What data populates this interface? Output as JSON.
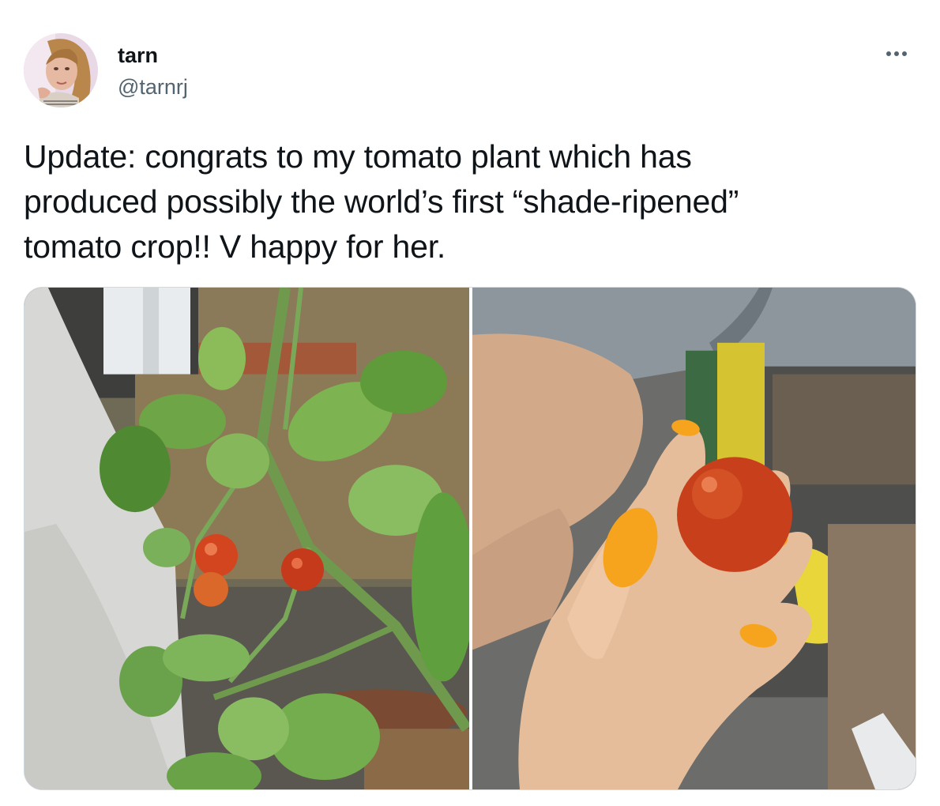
{
  "author": {
    "name": "tarn",
    "handle": "@tarnrj",
    "avatar_icon": "profile-photo"
  },
  "more_icon": "more-options-icon",
  "tweet": {
    "text": "Update: congrats to my tomato plant which has\nproduced possibly the world’s first “shade-ripened”\ntomato crop!! V happy for her."
  },
  "media": [
    {
      "name": "tomato-plant-photo"
    },
    {
      "name": "hand-holding-tomato-photo"
    }
  ],
  "colors": {
    "text": "#0f1419",
    "secondary_text": "#536471",
    "border": "#cfd9de"
  }
}
